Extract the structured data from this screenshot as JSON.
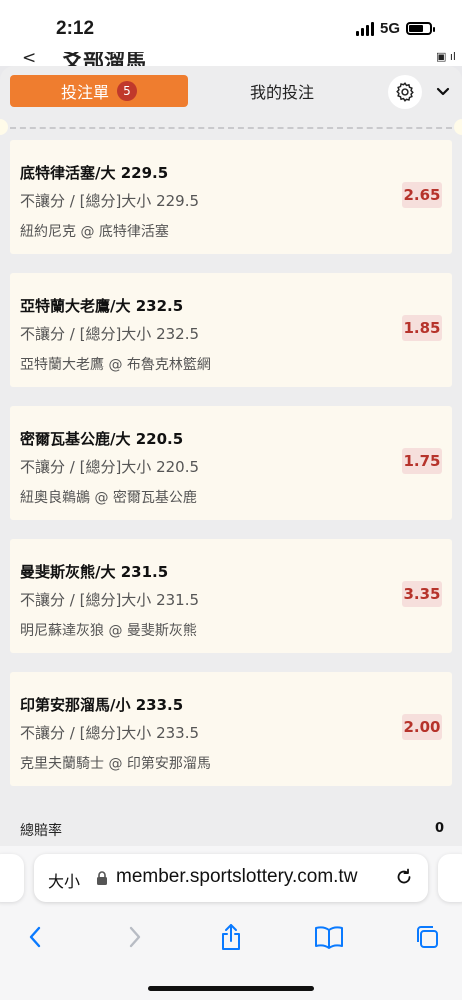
{
  "status": {
    "time": "2:12",
    "network": "5G"
  },
  "underlying": {
    "title": "爻部溜馬",
    "back_glyph": "<"
  },
  "tabs": {
    "betslip_label": "投注單",
    "betslip_count": "5",
    "mybets_label": "我的投注"
  },
  "icons": {
    "settings": "gear-icon",
    "collapse": "chevron-down-icon",
    "lock": "lock-icon",
    "reload": "reload-icon",
    "back": "back-icon",
    "forward": "forward-icon",
    "share": "share-icon",
    "bookmarks": "bookmarks-icon",
    "tabs": "tabs-icon"
  },
  "colors": {
    "accent": "#ef7d2f",
    "badge": "#c0392b",
    "odds_text": "#b6332b",
    "odds_bg": "#f6dfdc",
    "card_bg": "#fdf9ef",
    "ios_blue": "#0a7aff"
  },
  "bets": [
    {
      "title": "底特律活塞/大 229.5",
      "market": "不讓分 / [總分]大小 229.5",
      "match": "紐約尼克 @ 底特律活塞",
      "odds": "2.65"
    },
    {
      "title": "亞特蘭大老鷹/大 232.5",
      "market": "不讓分 / [總分]大小 232.5",
      "match": "亞特蘭大老鷹 @ 布魯克林籃網",
      "odds": "1.85"
    },
    {
      "title": "密爾瓦基公鹿/大 220.5",
      "market": "不讓分 / [總分]大小 220.5",
      "match": "紐奧良鵜鶘 @ 密爾瓦基公鹿",
      "odds": "1.75"
    },
    {
      "title": "曼斐斯灰熊/大 231.5",
      "market": "不讓分 / [總分]大小 231.5",
      "match": "明尼蘇達灰狼 @ 曼斐斯灰熊",
      "odds": "3.35"
    },
    {
      "title": "印第安那溜馬/小 233.5",
      "market": "不讓分 / [總分]大小 233.5",
      "match": "克里夫蘭騎士 @ 印第安那溜馬",
      "odds": "2.00"
    }
  ],
  "total": {
    "label": "總賠率",
    "value": "0"
  },
  "browser": {
    "text_size_label": "大小",
    "url": "member.sportslottery.com.tw"
  }
}
